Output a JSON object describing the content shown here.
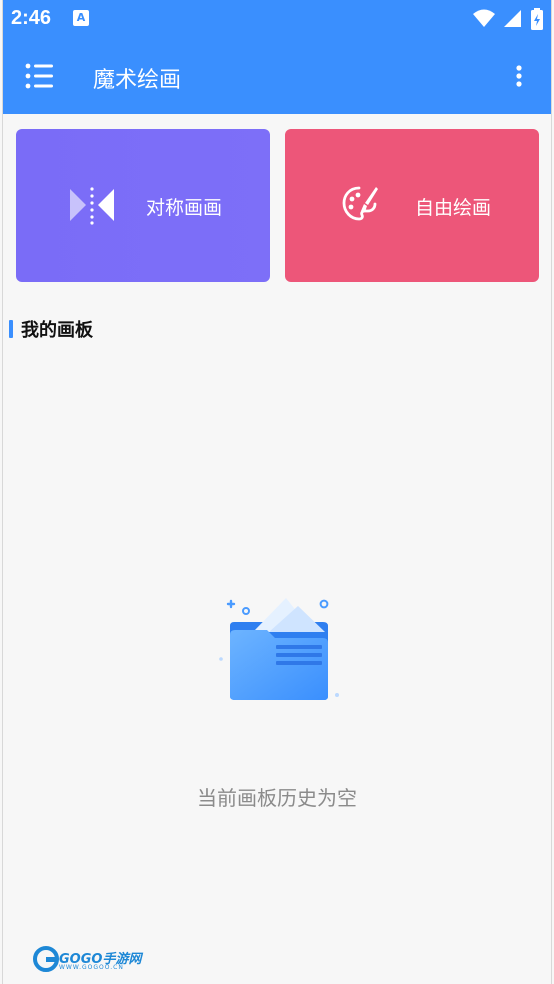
{
  "status_bar": {
    "time": "2:46",
    "notification_letter": "A"
  },
  "app_bar": {
    "title": "魔术绘画"
  },
  "cards": {
    "symmetric": {
      "label": "对称画画"
    },
    "free": {
      "label": "自由绘画"
    }
  },
  "section": {
    "title": "我的画板"
  },
  "empty_state": {
    "message": "当前画板历史为空"
  },
  "watermark": {
    "text": "GOGO手游网",
    "sub": "WWW.GOGOO.CN"
  },
  "colors": {
    "primary": "#3a8ffe",
    "symmetric_card": "#7a6cf7",
    "free_card": "#ed5679",
    "empty_text": "#8b8b8b"
  },
  "icons": [
    "menu-icon",
    "more-vert-icon",
    "mirror-icon",
    "palette-brush-icon",
    "empty-folder-icon",
    "wifi-icon",
    "signal-icon",
    "battery-icon"
  ]
}
